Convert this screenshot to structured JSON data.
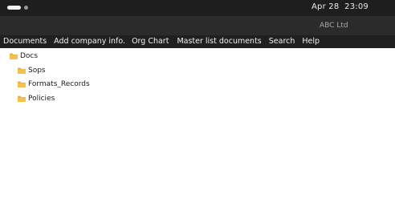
{
  "topbar": {
    "clock_date": "Apr 28",
    "clock_time": "23:09"
  },
  "window": {
    "title": "ABC Ltd"
  },
  "menu": [
    {
      "label": "Documents"
    },
    {
      "label": "Add company info."
    },
    {
      "label": "Org Chart"
    },
    {
      "label": "Master list documents"
    },
    {
      "label": "Search"
    },
    {
      "label": "Help"
    }
  ],
  "tree": {
    "root": {
      "label": "Docs",
      "icon": "folder-icon"
    },
    "children": [
      {
        "label": "Sops",
        "icon": "folder-icon"
      },
      {
        "label": "Formats_Records",
        "icon": "folder-icon"
      },
      {
        "label": "Policies",
        "icon": "folder-icon"
      }
    ]
  },
  "colors": {
    "topbar": "#1e1e1e",
    "titlebar": "#2b2b2b",
    "menubar": "#202020",
    "folder": "#e8b13a"
  }
}
